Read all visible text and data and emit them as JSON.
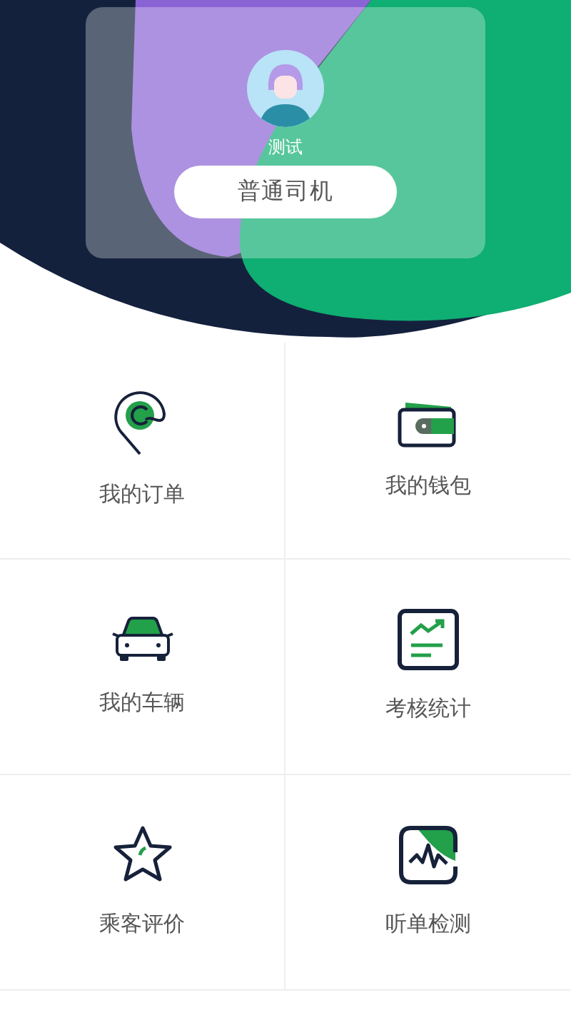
{
  "profile": {
    "name": "测试",
    "role": "普通司机"
  },
  "menu": [
    {
      "kind": "orders",
      "label": "我的订单"
    },
    {
      "kind": "wallet",
      "label": "我的钱包"
    },
    {
      "kind": "vehicle",
      "label": "我的车辆"
    },
    {
      "kind": "stats",
      "label": "考核统计"
    },
    {
      "kind": "rating",
      "label": "乘客评价"
    },
    {
      "kind": "monitor",
      "label": "听单检测"
    }
  ]
}
